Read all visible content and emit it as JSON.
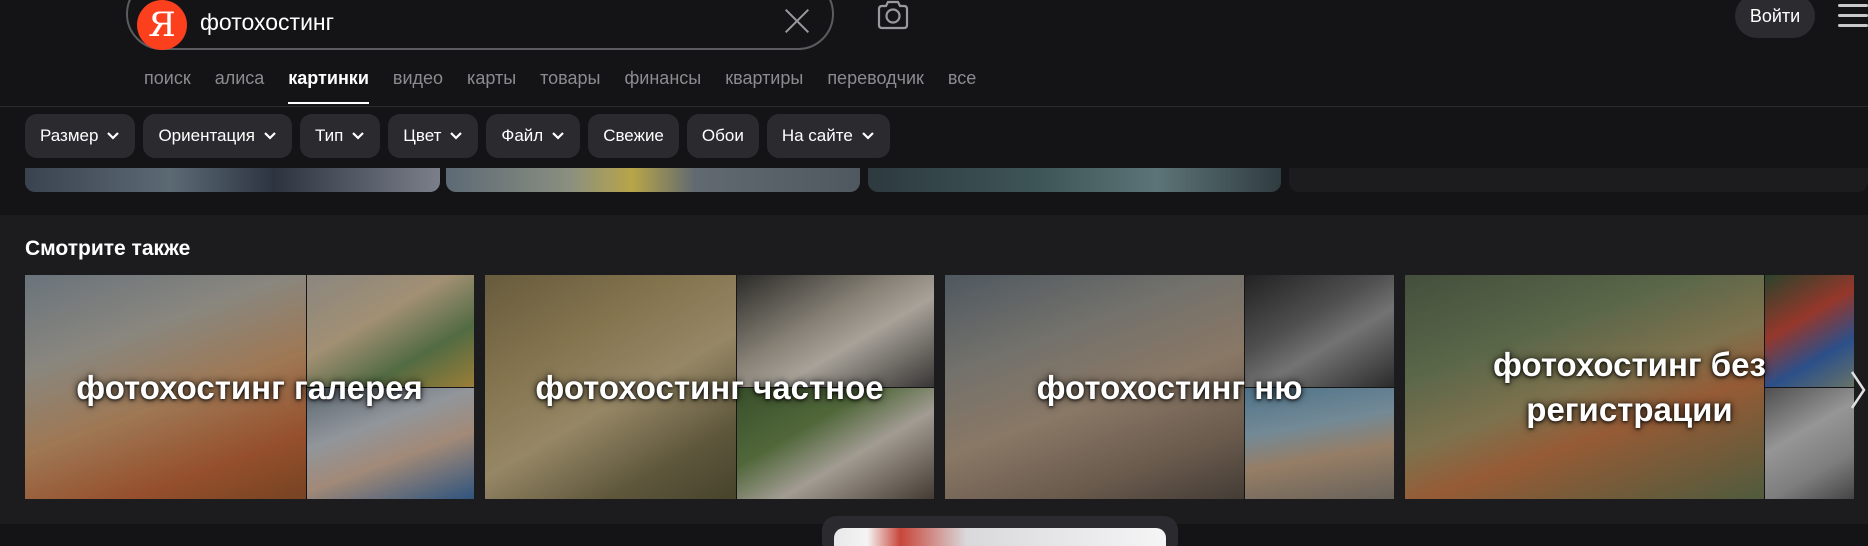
{
  "search": {
    "logo_letter": "Я",
    "query": "фотохостинг",
    "login_label": "Войти"
  },
  "nav": {
    "tabs": [
      {
        "label": "поиск"
      },
      {
        "label": "алиса"
      },
      {
        "label": "картинки",
        "active": true
      },
      {
        "label": "видео"
      },
      {
        "label": "карты"
      },
      {
        "label": "товары"
      },
      {
        "label": "финансы"
      },
      {
        "label": "квартиры"
      },
      {
        "label": "переводчик"
      },
      {
        "label": "все"
      }
    ]
  },
  "filters": [
    {
      "label": "Размер",
      "dropdown": true
    },
    {
      "label": "Ориентация",
      "dropdown": true
    },
    {
      "label": "Тип",
      "dropdown": true
    },
    {
      "label": "Цвет",
      "dropdown": true
    },
    {
      "label": "Файл",
      "dropdown": true
    },
    {
      "label": "Свежие",
      "dropdown": false
    },
    {
      "label": "Обои",
      "dropdown": false
    },
    {
      "label": "На сайте",
      "dropdown": true
    }
  ],
  "see_also": {
    "title": "Смотрите также",
    "cards": [
      {
        "label": "фотохостинг галерея"
      },
      {
        "label": "фотохостинг частное"
      },
      {
        "label": "фотохостинг ню"
      },
      {
        "label": "фотохостинг без регистрации"
      }
    ]
  },
  "colors": {
    "background": "#141416",
    "section_background": "#1c1c1f",
    "chip_background": "#2b2b2f",
    "logo_red": "#fc3f1d",
    "inactive_tab": "#8c8c90",
    "text": "#ffffff"
  }
}
